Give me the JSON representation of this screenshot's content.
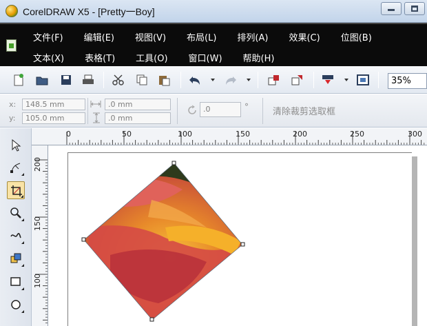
{
  "window": {
    "title": "CorelDRAW X5 - [Pretty一Boy]"
  },
  "menu": {
    "row1": [
      "文件(F)",
      "编辑(E)",
      "视图(V)",
      "布局(L)",
      "排列(A)",
      "效果(C)",
      "位图(B)"
    ],
    "row2": [
      "文本(X)",
      "表格(T)",
      "工具(O)",
      "窗口(W)",
      "帮助(H)"
    ]
  },
  "toolbar": {
    "zoom": "35%",
    "icons": [
      "new-document-icon",
      "open-icon",
      "save-icon",
      "print-icon",
      "cut-icon",
      "copy-icon",
      "paste-icon",
      "undo-icon",
      "redo-icon",
      "import-icon",
      "export-icon",
      "application-launcher-icon",
      "welcome-screen-icon"
    ]
  },
  "propbar": {
    "x_label": "x:",
    "x_value": "148.5 mm",
    "y_label": "y:",
    "y_value": "105.0 mm",
    "width_value": ".0 mm",
    "height_value": ".0 mm",
    "angle_value": ".0",
    "angle_unit": "°",
    "clear_clip_label": "清除裁剪选取框"
  },
  "tools": [
    "pick-tool-icon",
    "shape-tool-icon",
    "crop-tool-icon",
    "zoom-tool-icon",
    "freehand-tool-icon",
    "smart-fill-tool-icon",
    "rectangle-tool-icon",
    "ellipse-tool-icon"
  ],
  "ruler": {
    "top_labels": [
      "0",
      "50",
      "100",
      "150",
      "200",
      "250",
      "300"
    ],
    "left_labels": [
      "200",
      "150",
      "100"
    ]
  },
  "colors": {
    "menubar_bg": "#0b0b0b",
    "titlebar_bg": "#c9d9ee",
    "active_tool": "#f9e3a6"
  }
}
